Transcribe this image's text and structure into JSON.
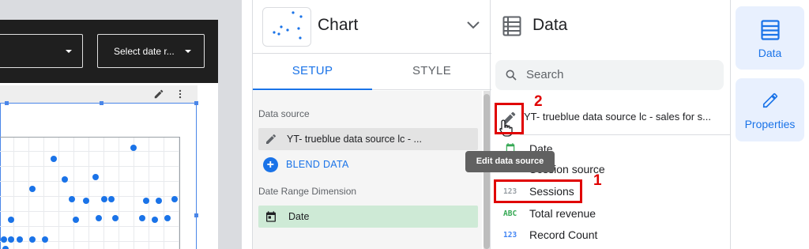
{
  "canvas": {
    "date_range_control": "Select date r...",
    "chart_points": [
      [
        0.3,
        0.19
      ],
      [
        0.18,
        0.46
      ],
      [
        0.74,
        0.09
      ],
      [
        0.36,
        0.37
      ],
      [
        0.53,
        0.35
      ],
      [
        0.4,
        0.55
      ],
      [
        0.48,
        0.56
      ],
      [
        0.58,
        0.55
      ],
      [
        0.62,
        0.55
      ],
      [
        0.81,
        0.56
      ],
      [
        0.88,
        0.56
      ],
      [
        0.97,
        0.55
      ],
      [
        0.42,
        0.73
      ],
      [
        0.55,
        0.72
      ],
      [
        0.64,
        0.72
      ],
      [
        0.79,
        0.72
      ],
      [
        0.86,
        0.73
      ],
      [
        0.93,
        0.72
      ],
      [
        0.06,
        0.73
      ],
      [
        0.02,
        0.91
      ],
      [
        0.06,
        0.91
      ],
      [
        0.11,
        0.91
      ],
      [
        0.18,
        0.91
      ],
      [
        0.25,
        0.91
      ],
      [
        0.03,
        0.99
      ]
    ]
  },
  "chart_panel": {
    "title": "Chart",
    "tabs": [
      "SETUP",
      "STYLE"
    ],
    "data_source_label": "Data source",
    "data_source_value": "YT- trueblue data source lc - ...",
    "blend_label": "BLEND DATA",
    "date_range_label": "Date Range Dimension",
    "date_range_value": "Date"
  },
  "data_panel": {
    "title": "Data",
    "search_placeholder": "Search",
    "data_source_name": "YT- trueblue data source lc - sales for s...",
    "fields": [
      {
        "type": "",
        "name": "Date"
      },
      {
        "type": "",
        "name": "Session source"
      },
      {
        "type": "123",
        "name": "Sessions"
      },
      {
        "type": "ABC",
        "name": "Total revenue"
      },
      {
        "type": "123",
        "name": "Record Count"
      }
    ],
    "tooltip": "Edit data source",
    "callout_1": "1",
    "callout_2": "2"
  },
  "rail": {
    "data_label": "Data",
    "properties_label": "Properties"
  },
  "colors": {
    "accent": "#1a73e8",
    "callout": "#e00000",
    "date_chip": "#ceead6"
  }
}
